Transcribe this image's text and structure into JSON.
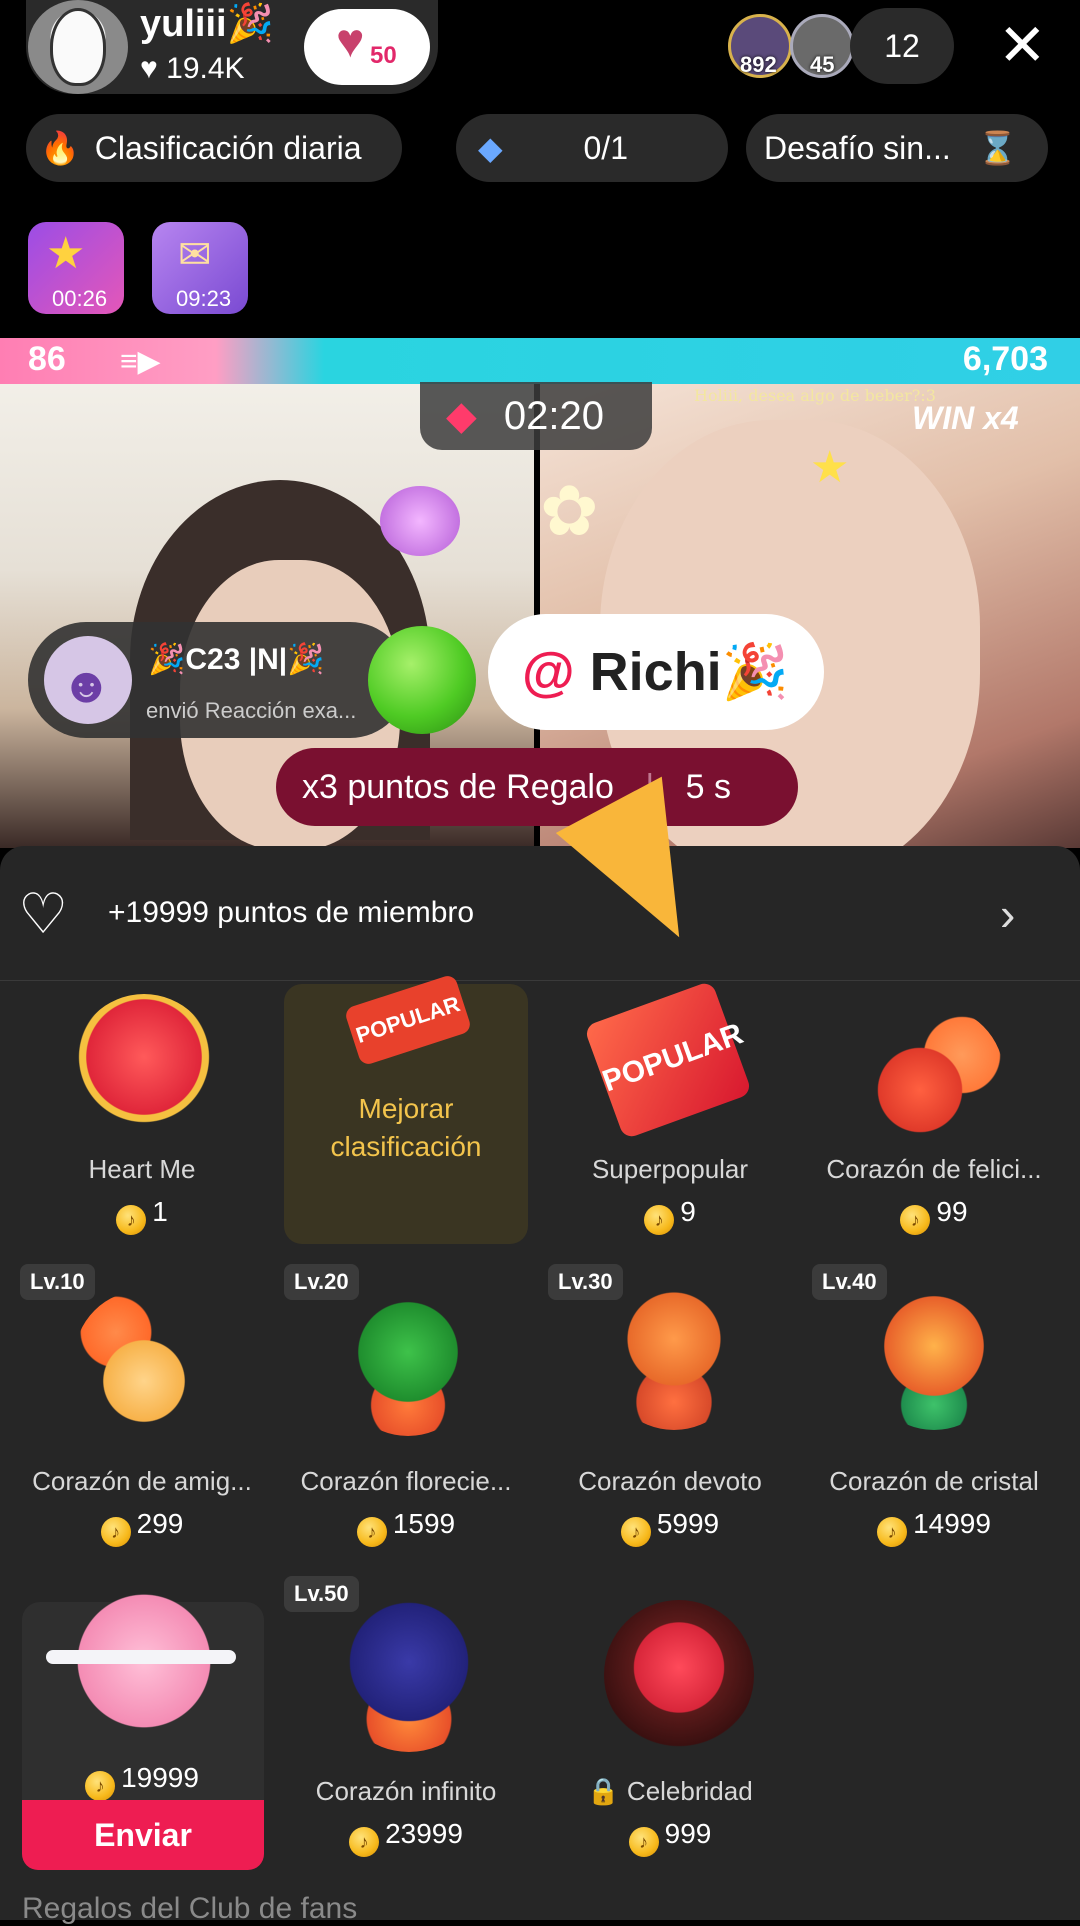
{
  "host": {
    "name": "yuliii🎉",
    "likes": "♥ 19.4K",
    "fan_badge": "50"
  },
  "viewers": {
    "badge_1": "892",
    "badge_2": "45",
    "count": "12"
  },
  "topbar": {
    "close": "✕"
  },
  "pills": {
    "daily_rank": "Clasificación diaria",
    "progress": "0/1",
    "challenge": "Desafío sin..."
  },
  "treasures": [
    {
      "time": "00:26"
    },
    {
      "time": "09:23"
    }
  ],
  "battle": {
    "score_left": "86",
    "score_right": "6,703",
    "timer": "02:20",
    "win": "WIN x4",
    "caption": "Holiii, desea algo de beber?:3"
  },
  "notification": {
    "name": "🎉C23 |N|🎉",
    "message": "envió Reacción exa..."
  },
  "mention": {
    "at": "@",
    "name": " Richi🎉"
  },
  "points_banner": {
    "label": "x3 puntos de Regalo",
    "time": "5 s"
  },
  "member": {
    "text": "+19999 puntos de miembro"
  },
  "boost": {
    "label": "Mejorar clasificación"
  },
  "gifts": [
    {
      "name": "Heart Me",
      "price": "1"
    },
    {
      "name": "Superpopular",
      "price": "9"
    },
    {
      "name": "Corazón de felici...",
      "price": "99"
    },
    {
      "name": "Corazón de amig...",
      "price": "299",
      "level": "Lv.10"
    },
    {
      "name": "Corazón florecie...",
      "price": "1599",
      "level": "Lv.20"
    },
    {
      "name": "Corazón devoto",
      "price": "5999",
      "level": "Lv.30"
    },
    {
      "name": "Corazón de cristal",
      "price": "14999",
      "level": "Lv.40"
    },
    {
      "name": "",
      "price": "19999"
    },
    {
      "name": "Corazón infinito",
      "price": "23999",
      "level": "Lv.50"
    },
    {
      "name": "Celebridad",
      "price": "999"
    }
  ],
  "send": {
    "label": "Enviar"
  },
  "fans_section": {
    "title": "Regalos del Club de fans"
  },
  "icons": {
    "popular_label": "POPULAR",
    "coin": "♪"
  },
  "colors": {
    "accent": "#ee1d52",
    "gold": "#f3c44c",
    "panel": "#262626"
  }
}
